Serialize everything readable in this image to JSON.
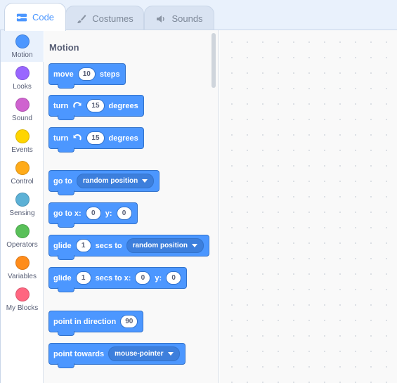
{
  "tabs": [
    {
      "label": "Code",
      "active": true,
      "icon": "code-icon"
    },
    {
      "label": "Costumes",
      "active": false,
      "icon": "brush-icon"
    },
    {
      "label": "Sounds",
      "active": false,
      "icon": "speaker-icon"
    }
  ],
  "categories": [
    {
      "label": "Motion",
      "color": "#4c97ff"
    },
    {
      "label": "Looks",
      "color": "#9966ff"
    },
    {
      "label": "Sound",
      "color": "#cf63cf"
    },
    {
      "label": "Events",
      "color": "#ffd500"
    },
    {
      "label": "Control",
      "color": "#ffab19"
    },
    {
      "label": "Sensing",
      "color": "#5cb1d6"
    },
    {
      "label": "Operators",
      "color": "#59c059"
    },
    {
      "label": "Variables",
      "color": "#ff8c1a"
    },
    {
      "label": "My Blocks",
      "color": "#ff6680"
    }
  ],
  "flyout": {
    "title": "Motion",
    "blocks": {
      "move": {
        "text1": "move",
        "steps": "10",
        "text2": "steps"
      },
      "turn_right": {
        "text1": "turn",
        "degrees": "15",
        "text2": "degrees"
      },
      "turn_left": {
        "text1": "turn",
        "degrees": "15",
        "text2": "degrees"
      },
      "go_to": {
        "text1": "go to",
        "option": "random position"
      },
      "go_to_xy": {
        "text1": "go to x:",
        "x": "0",
        "text2": "y:",
        "y": "0"
      },
      "glide_to": {
        "text1": "glide",
        "secs": "1",
        "text2": "secs to",
        "option": "random position"
      },
      "glide_xy": {
        "text1": "glide",
        "secs": "1",
        "text2": "secs to x:",
        "x": "0",
        "text3": "y:",
        "y": "0"
      },
      "point_dir": {
        "text1": "point in direction",
        "dir": "90"
      },
      "point_towards": {
        "text1": "point towards",
        "option": "mouse-pointer"
      }
    }
  }
}
